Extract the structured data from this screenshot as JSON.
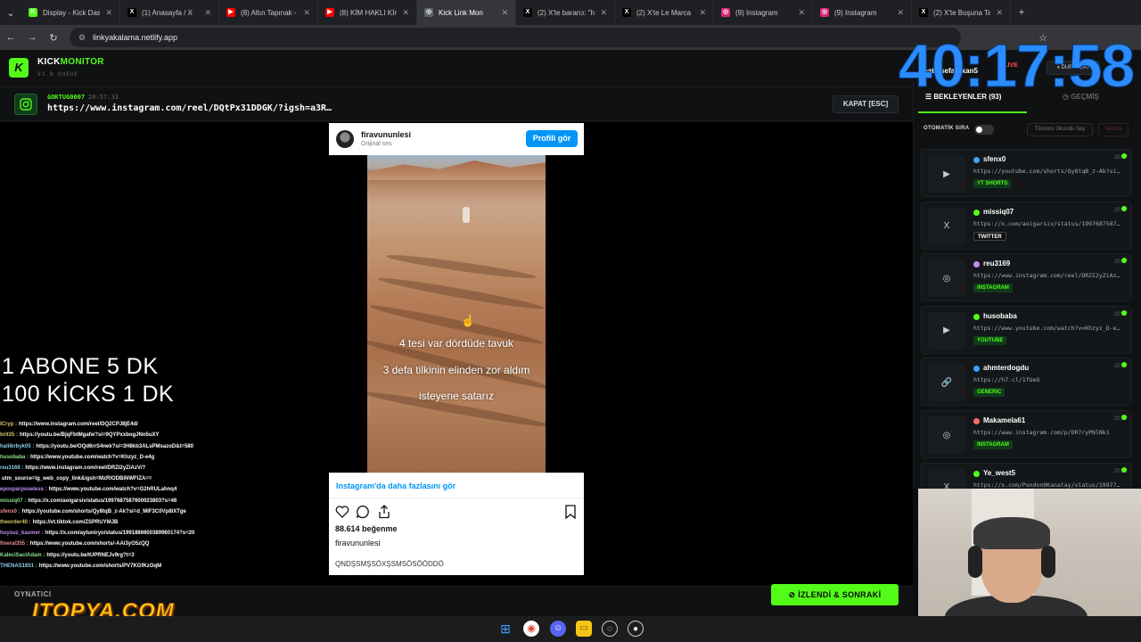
{
  "browser": {
    "tabs": [
      {
        "title": "Display - Kick Dash",
        "favicon_color": "#53fc18",
        "favicon": "K",
        "active": false
      },
      {
        "title": "(1) Anasayfa / X",
        "favicon_color": "#000000",
        "favicon": "X",
        "active": false
      },
      {
        "title": "(8) Altın Tapınak - ",
        "favicon_color": "#ff0000",
        "favicon": "▶",
        "active": false
      },
      {
        "title": "(8) KİM HAKLI Kİn",
        "favicon_color": "#ff0000",
        "favicon": "▶",
        "active": false
      },
      {
        "title": "Kick Link Mon",
        "favicon_color": "#5f6368",
        "favicon": "◎",
        "active": true
      },
      {
        "title": "(2) X'te baranɔ: \"ht",
        "favicon_color": "#000000",
        "favicon": "X",
        "active": false
      },
      {
        "title": "(2) X'te Le Marca",
        "favicon_color": "#000000",
        "favicon": "X",
        "active": false
      },
      {
        "title": "(9) Instagram",
        "favicon_color": "#d62976",
        "favicon": "◎",
        "active": false
      },
      {
        "title": "(9) Instagram",
        "favicon_color": "#d62976",
        "favicon": "◎",
        "active": false
      },
      {
        "title": "(2) X'te Boşuna Ta",
        "favicon_color": "#000000",
        "favicon": "X",
        "active": false
      }
    ],
    "url": "linkyakalama.netlify.app"
  },
  "app": {
    "brand_white": "KICK",
    "brand_green": "MONITOR",
    "version": "V3.0 QUEUE",
    "current_user": "GOKTUG0007",
    "current_time": "20:57:33",
    "current_link": "https://www.instagram.com/reel/DQtPx31DDGK/?igsh=a3R…",
    "close_button": "KAPAT [ESC]",
    "footer_label": "OYNATICI",
    "watch_button": "İZLENDİ & SONRAKİ"
  },
  "instagram": {
    "username": "firavununlesi",
    "subtitle": "Orijinal ses",
    "profile_button": "Profili gör",
    "caption_lines": [
      "4 tesi var dördüde tavuk",
      "3 defa tilkinin elinden zor aldım",
      "isteyene satarız"
    ],
    "more_link": "Instagram'da daha fazlasını gör",
    "likes": "88.614 beğenme",
    "owner": "firavununlesi",
    "comment": "QNDŞSMŞSÖXŞSMSÖSÖÖDDÖ"
  },
  "overlay": {
    "line1": "1 ABONE 5 DK",
    "line2": "100 KİCKS  1 DK",
    "chat": [
      {
        "user": "",
        "text": "",
        "cls": "b"
      },
      {
        "user": "ICryp :",
        "text": "https://www.instagram.com/reel/DQ2CPJ8jE4d/",
        "cls": "b"
      },
      {
        "user": "brit35 :",
        "text": "https://youtu.be/BjqFbtMgafw?si=9QYPxxbogJNn5uXY",
        "cls": "b"
      },
      {
        "user": "halilkrbyk05 :",
        "text": "https://youtu.be/OQd6rrS4nek?si=3H8kb3ALsPMsazoD&t=580",
        "cls": "c"
      },
      {
        "user": "husobaba :",
        "text": "https://www.youtube.com/watch?v=Khzyz_D-e4g",
        "cls": "g"
      },
      {
        "user": "reu3169 :",
        "text": "https://www.instagram.com/reel/DRZI2yZiAzV/?",
        "cls": "c"
      },
      {
        "user": "",
        "text": "utm_source=ig_web_copy_link&igsh=MzRlODBiNWFlZA==",
        "cls": "b"
      },
      {
        "user": "eposparposeless :",
        "text": "https://www.youtube.com/watch?v=G2hRULahnq4",
        "cls": "p"
      },
      {
        "user": "missiq07 :",
        "text": "https://x.com/aoigarsiv/status/1997687587600023803?s=46",
        "cls": "g"
      },
      {
        "user": "sfenx0 :",
        "text": "https://youtube.com/shorts/Qy8tqB_z-Ak?si=d_MlF3C0Vp8IXTge",
        "cls": "r"
      },
      {
        "user": "theorder40 :",
        "text": "https://vt.tiktok.com/ZSPRUYMJB",
        "cls": "b"
      },
      {
        "user": "huysuz_kasmer :",
        "text": "https://x.com/aytuniryo/status/1991886600389960174?s=20",
        "cls": "p"
      },
      {
        "user": "fineral355 :",
        "text": "https://www.youtube.com/shorts/-AAi3yO5zQQ",
        "cls": "r"
      },
      {
        "user": "KaleciSaclAdam :",
        "text": "https://youtu.be/tUPRNEJv9rg?t=3",
        "cls": "g"
      },
      {
        "user": "THENAS1651 :",
        "text": "https://www.youtube.com/shorts/PV7KGfKzOqM",
        "cls": "c"
      }
    ],
    "sponsor": "ITOPYA.COM"
  },
  "panel": {
    "timer": "40:17:58",
    "streamer": "batinsefaerkan5",
    "live": "LIVE",
    "pause": "DURAKLAT",
    "tab_waiting": "BEKLEYENLER (93)",
    "tab_history": "GEÇMİŞ",
    "auto_queue": "OTOMATİK SIRA",
    "mark_all": "Tümünü Okundu Say",
    "clear": "Temizle",
    "queue": [
      {
        "name": "sfenx0",
        "time": "20:57",
        "link": "https://youtube.com/shorts/Qy8tqB_z-Ak?si…",
        "tag": "YT SHORTS",
        "dot": "#3ba3ff",
        "thumb": "▶"
      },
      {
        "name": "missiq07",
        "time": "20:57",
        "link": "https://x.com/aoigarsiv/status/1997687587…",
        "tag": "TWITTER",
        "dot": "#53fc18",
        "thumb": "X"
      },
      {
        "name": "reu3169",
        "time": "20:57",
        "link": "https://www.instagram.com/reel/DRZI2yZiAz…",
        "tag": "INSTAGRAM",
        "dot": "#c38ef0",
        "thumb": "◎"
      },
      {
        "name": "husobaba",
        "time": "20:57",
        "link": "https://www.youtube.com/watch?v=Khzyz_D-e…",
        "tag": "YOUTUBE",
        "dot": "#53fc18",
        "thumb": "▶"
      },
      {
        "name": "ahmterdogdu",
        "time": "20:57",
        "link": "https://h7.cl/1fUeO",
        "tag": "GENERIC",
        "dot": "#3ba3ff",
        "thumb": "🔗"
      },
      {
        "name": "Makamela61",
        "time": "20:57",
        "link": "https://www.instagram.com/p/DR7ryPNlNk1",
        "tag": "INSTAGRAM",
        "dot": "#ff6b6b",
        "thumb": "◎"
      },
      {
        "name": "Ye_west5",
        "time": "20:57",
        "link": "https://x.com/Pondon0Kanatay/status/19977…",
        "tag": "",
        "dot": "#53fc18",
        "thumb": "X"
      }
    ]
  }
}
